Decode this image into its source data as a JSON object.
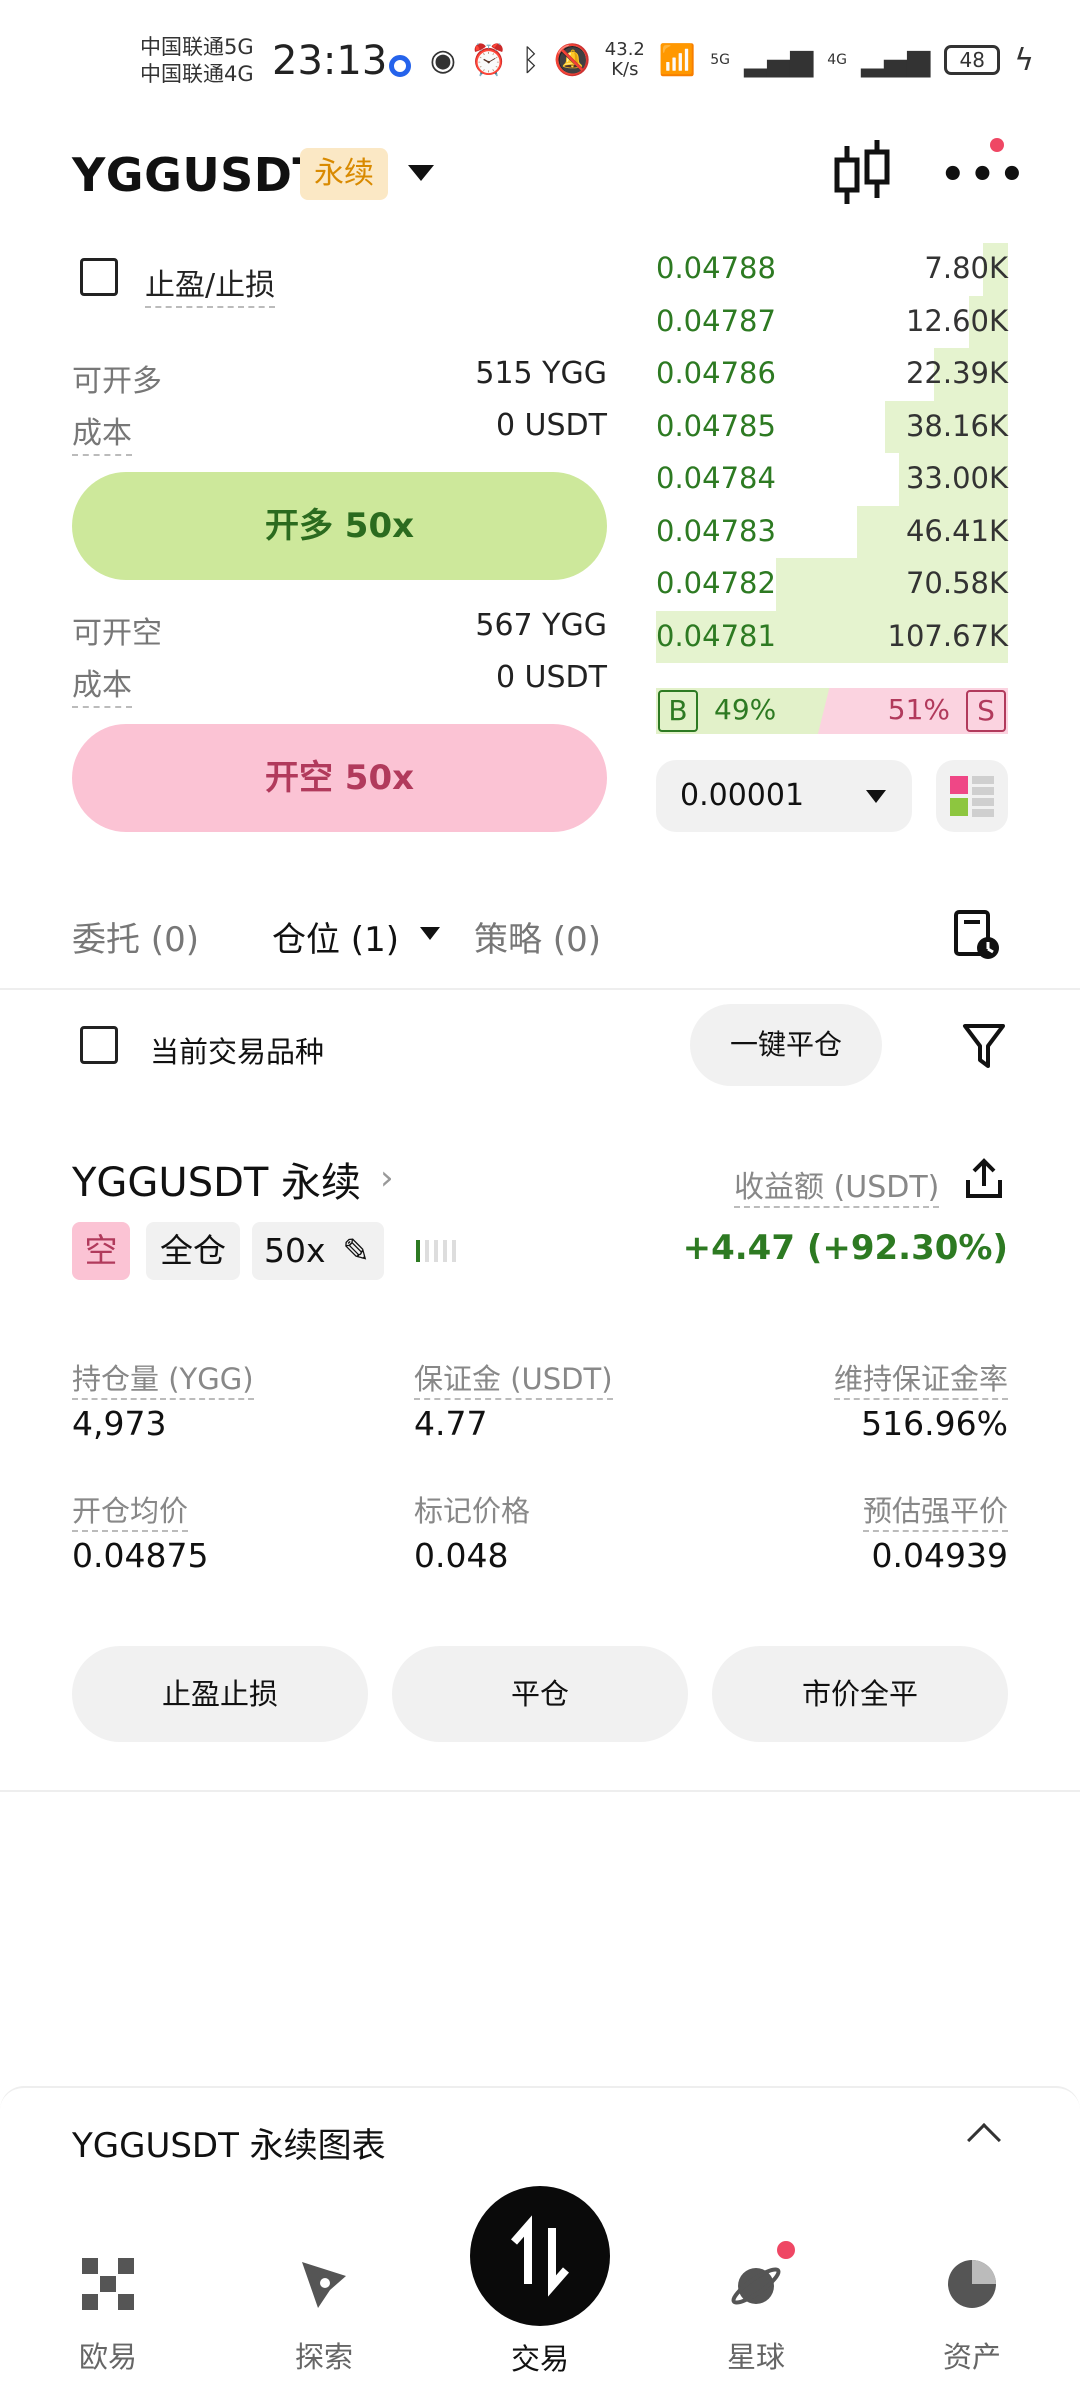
{
  "status_bar": {
    "carrier1": "中国联通5G",
    "carrier2": "中国联通4G",
    "time": "23:13",
    "speed_value": "43.2",
    "speed_unit": "K/s",
    "net1": "5G",
    "net2": "4G",
    "battery": "48"
  },
  "header": {
    "pair": "YGGUSDT",
    "badge": "永续"
  },
  "form": {
    "tpsl_label": "止盈/止损",
    "long_avail_label": "可开多",
    "long_avail_value": "515 YGG",
    "long_cost_label": "成本",
    "long_cost_value": "0 USDT",
    "long_button": "开多 50x",
    "short_avail_label": "可开空",
    "short_avail_value": "567 YGG",
    "short_cost_label": "成本",
    "short_cost_value": "0 USDT",
    "short_button": "开空 50x"
  },
  "order_book": {
    "rows": [
      {
        "price": "0.04788",
        "size": "7.80K",
        "depth": 0.07
      },
      {
        "price": "0.04787",
        "size": "12.60K",
        "depth": 0.11
      },
      {
        "price": "0.04786",
        "size": "22.39K",
        "depth": 0.21
      },
      {
        "price": "0.04785",
        "size": "38.16K",
        "depth": 0.35
      },
      {
        "price": "0.04784",
        "size": "33.00K",
        "depth": 0.31
      },
      {
        "price": "0.04783",
        "size": "46.41K",
        "depth": 0.43
      },
      {
        "price": "0.04782",
        "size": "70.58K",
        "depth": 0.66
      },
      {
        "price": "0.04781",
        "size": "107.67K",
        "depth": 1.0
      }
    ],
    "buy_tag": "B",
    "buy_pct": "49%",
    "buy_ratio": 0.49,
    "sell_tag": "S",
    "sell_pct": "51%",
    "precision": "0.00001"
  },
  "tabs": {
    "orders": "委托 (0)",
    "positions": "仓位 (1)",
    "strategies": "策略 (0)"
  },
  "filter": {
    "current_only": "当前交易品种",
    "close_all": "一键平仓"
  },
  "position": {
    "title": "YGGUSDT 永续",
    "pnl_label": "收益额 (USDT)",
    "side": "空",
    "margin_mode": "全仓",
    "leverage": "50x",
    "pnl_value": "+4.47 (+92.30%)",
    "qty_label": "持仓量 (YGG)",
    "qty_value": "4,973",
    "margin_label": "保证金 (USDT)",
    "margin_value": "4.77",
    "mmr_label": "维持保证金率",
    "mmr_value": "516.96%",
    "entry_label": "开仓均价",
    "entry_value": "0.04875",
    "mark_label": "标记价格",
    "mark_value": "0.048",
    "liq_label": "预估强平价",
    "liq_value": "0.04939",
    "btn_tpsl": "止盈止损",
    "btn_close": "平仓",
    "btn_market_close": "市价全平"
  },
  "chart_panel": {
    "title": "YGGUSDT 永续图表"
  },
  "nav": {
    "home": "欧易",
    "explore": "探索",
    "trade": "交易",
    "planet": "星球",
    "assets": "资产"
  }
}
